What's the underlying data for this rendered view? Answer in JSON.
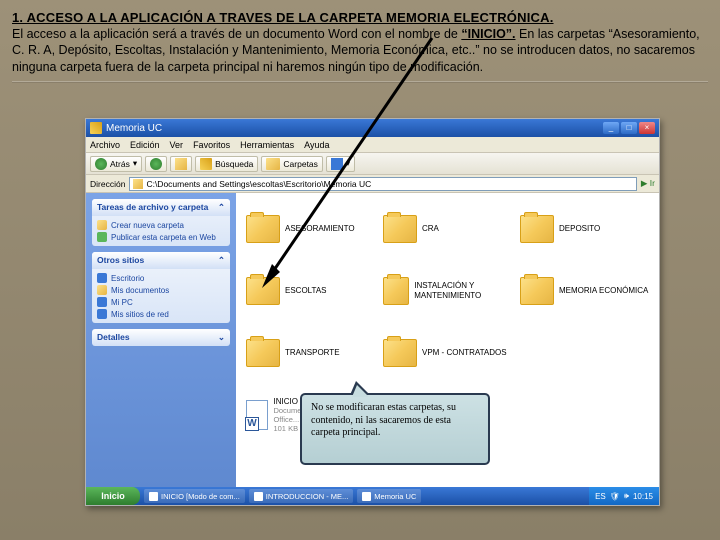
{
  "heading": "1. ACCESO A LA APLICACIÓN A TRAVES DE LA CARPETA MEMORIA ELECTRÓNICA.",
  "body": {
    "p1a": "El acceso a la aplicación será a través de un documento Word con el nombre de ",
    "p1b": "“INICIO”.",
    "p1c": " En las carpetas “Asesoramiento, C. R. A, Depósito, Escoltas, Instalación y Mantenimiento, Memoria Económica, etc..” no se introducen datos, no sacaremos ninguna carpeta fuera de la carpeta principal ni haremos  ningún tipo de modificación."
  },
  "window": {
    "title": "Memoria UC",
    "menu": [
      "Archivo",
      "Edición",
      "Ver",
      "Favoritos",
      "Herramientas",
      "Ayuda"
    ],
    "toolbar": {
      "back": "Atrás",
      "search": "Búsqueda",
      "folders": "Carpetas"
    },
    "address": {
      "label": "Dirección",
      "value": "C:\\Documents and Settings\\escoltas\\Escritorio\\Memoria UC",
      "go": "Ir"
    }
  },
  "side": {
    "panel1": {
      "title": "Tareas de archivo y carpeta",
      "items": [
        "Crear nueva carpeta",
        "Publicar esta carpeta en Web"
      ]
    },
    "panel2": {
      "title": "Otros sitios",
      "items": [
        "Escritorio",
        "Mis documentos",
        "Mi PC",
        "Mis sitios de red"
      ]
    },
    "panel3": {
      "title": "Detalles"
    }
  },
  "folders": [
    {
      "name": "ASESORAMIENTO"
    },
    {
      "name": "CRA"
    },
    {
      "name": "DEPOSITO"
    },
    {
      "name": "ESCOLTAS"
    },
    {
      "name": "INSTALACIÓN Y MANTENIMIENTO"
    },
    {
      "name": "MEMORIA ECONÓMICA"
    },
    {
      "name": "TRANSPORTE"
    },
    {
      "name": "VPM - CONTRATADOS"
    }
  ],
  "file": {
    "name": "INICIO",
    "sub1": "Documento de Microsoft Office...",
    "sub2": "101 KB"
  },
  "callout": "No se modificaran estas carpetas, su contenido, ni las sacaremos de esta carpeta principal.",
  "taskbar": {
    "start": "Inicio",
    "items": [
      "INICIO [Modo de com...",
      "INTRODUCCION - ME...",
      "Memoria UC"
    ],
    "lang": "ES",
    "time": "10:15"
  }
}
